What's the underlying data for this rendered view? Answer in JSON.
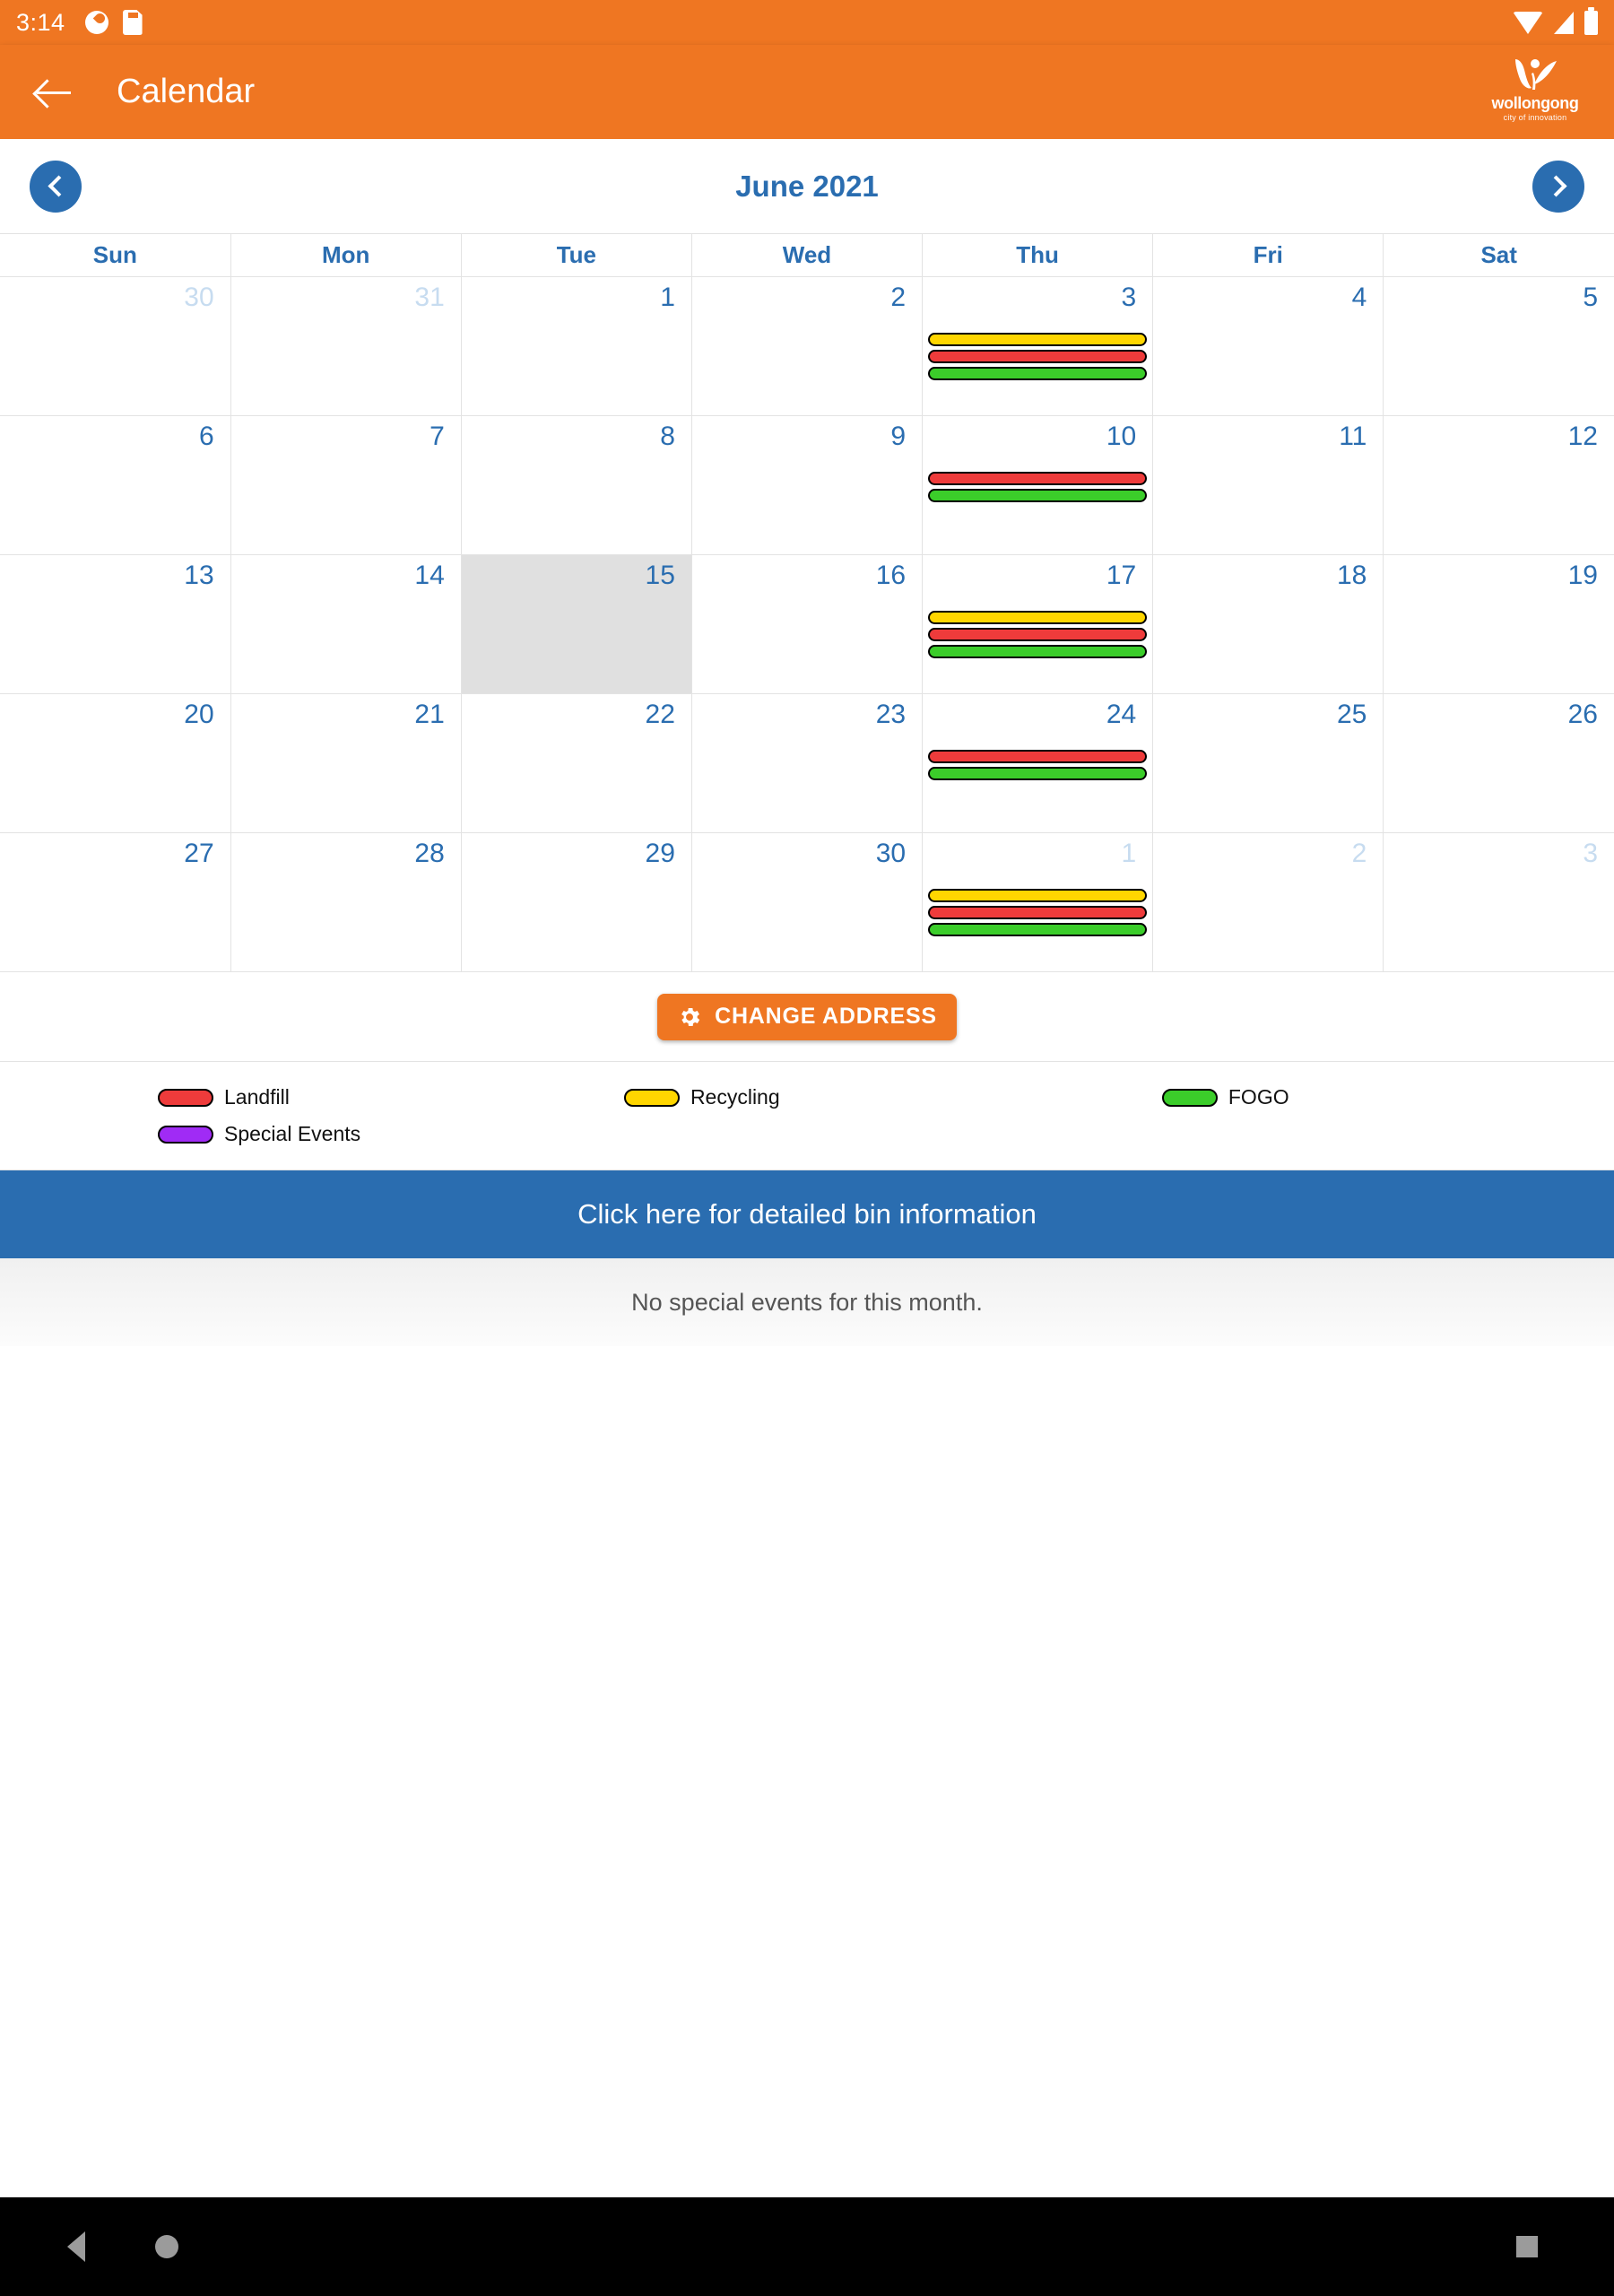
{
  "status_bar": {
    "time": "3:14",
    "left_icons": [
      "cast-icon",
      "sd-card-icon"
    ],
    "right_icons": [
      "wifi-icon",
      "cellular-signal-icon",
      "battery-icon"
    ]
  },
  "app_bar": {
    "back_label": "back-arrow",
    "title": "Calendar",
    "logo_name": "wollongong",
    "logo_tagline": "city of innovation"
  },
  "month_nav": {
    "prev_label": "Previous month",
    "next_label": "Next month",
    "current_month": "June 2021"
  },
  "calendar": {
    "weekday_headers": [
      "Sun",
      "Mon",
      "Tue",
      "Wed",
      "Thu",
      "Fri",
      "Sat"
    ],
    "weeks": [
      [
        {
          "day": "30",
          "muted": true,
          "selected": false,
          "bins": []
        },
        {
          "day": "31",
          "muted": true,
          "selected": false,
          "bins": []
        },
        {
          "day": "1",
          "muted": false,
          "selected": false,
          "bins": []
        },
        {
          "day": "2",
          "muted": false,
          "selected": false,
          "bins": []
        },
        {
          "day": "3",
          "muted": false,
          "selected": false,
          "bins": [
            "recycling",
            "landfill",
            "fogo"
          ]
        },
        {
          "day": "4",
          "muted": false,
          "selected": false,
          "bins": []
        },
        {
          "day": "5",
          "muted": false,
          "selected": false,
          "bins": []
        }
      ],
      [
        {
          "day": "6",
          "muted": false,
          "selected": false,
          "bins": []
        },
        {
          "day": "7",
          "muted": false,
          "selected": false,
          "bins": []
        },
        {
          "day": "8",
          "muted": false,
          "selected": false,
          "bins": []
        },
        {
          "day": "9",
          "muted": false,
          "selected": false,
          "bins": []
        },
        {
          "day": "10",
          "muted": false,
          "selected": false,
          "bins": [
            "landfill",
            "fogo"
          ]
        },
        {
          "day": "11",
          "muted": false,
          "selected": false,
          "bins": []
        },
        {
          "day": "12",
          "muted": false,
          "selected": false,
          "bins": []
        }
      ],
      [
        {
          "day": "13",
          "muted": false,
          "selected": false,
          "bins": []
        },
        {
          "day": "14",
          "muted": false,
          "selected": false,
          "bins": []
        },
        {
          "day": "15",
          "muted": false,
          "selected": true,
          "bins": []
        },
        {
          "day": "16",
          "muted": false,
          "selected": false,
          "bins": []
        },
        {
          "day": "17",
          "muted": false,
          "selected": false,
          "bins": [
            "recycling",
            "landfill",
            "fogo"
          ]
        },
        {
          "day": "18",
          "muted": false,
          "selected": false,
          "bins": []
        },
        {
          "day": "19",
          "muted": false,
          "selected": false,
          "bins": []
        }
      ],
      [
        {
          "day": "20",
          "muted": false,
          "selected": false,
          "bins": []
        },
        {
          "day": "21",
          "muted": false,
          "selected": false,
          "bins": []
        },
        {
          "day": "22",
          "muted": false,
          "selected": false,
          "bins": []
        },
        {
          "day": "23",
          "muted": false,
          "selected": false,
          "bins": []
        },
        {
          "day": "24",
          "muted": false,
          "selected": false,
          "bins": [
            "landfill",
            "fogo"
          ]
        },
        {
          "day": "25",
          "muted": false,
          "selected": false,
          "bins": []
        },
        {
          "day": "26",
          "muted": false,
          "selected": false,
          "bins": []
        }
      ],
      [
        {
          "day": "27",
          "muted": false,
          "selected": false,
          "bins": []
        },
        {
          "day": "28",
          "muted": false,
          "selected": false,
          "bins": []
        },
        {
          "day": "29",
          "muted": false,
          "selected": false,
          "bins": []
        },
        {
          "day": "30",
          "muted": false,
          "selected": false,
          "bins": []
        },
        {
          "day": "1",
          "muted": true,
          "selected": false,
          "bins": [
            "recycling",
            "landfill",
            "fogo"
          ]
        },
        {
          "day": "2",
          "muted": true,
          "selected": false,
          "bins": []
        },
        {
          "day": "3",
          "muted": true,
          "selected": false,
          "bins": []
        }
      ]
    ]
  },
  "change_address": {
    "label": "CHANGE ADDRESS",
    "icon": "gear-icon"
  },
  "legend": {
    "items": [
      {
        "label": "Landfill",
        "color": "#ee3b3b",
        "key": "landfill"
      },
      {
        "label": "Recycling",
        "color": "#ffd600",
        "key": "recycling"
      },
      {
        "label": "FOGO",
        "color": "#3bcd2a",
        "key": "fogo"
      },
      {
        "label": "Special Events",
        "color": "#a02bf5",
        "key": "special"
      }
    ]
  },
  "bin_banner": {
    "label": "Click here for detailed bin information"
  },
  "events": {
    "empty_message": "No special events for this month."
  },
  "android_nav": {
    "back": "back-icon",
    "home": "home-icon",
    "recents": "recents-icon"
  },
  "colors": {
    "brand_orange": "#ef7622",
    "brand_blue": "#2a6db0",
    "selected_day": "#e0e0e0",
    "muted_day_text": "#c7dcf0"
  }
}
